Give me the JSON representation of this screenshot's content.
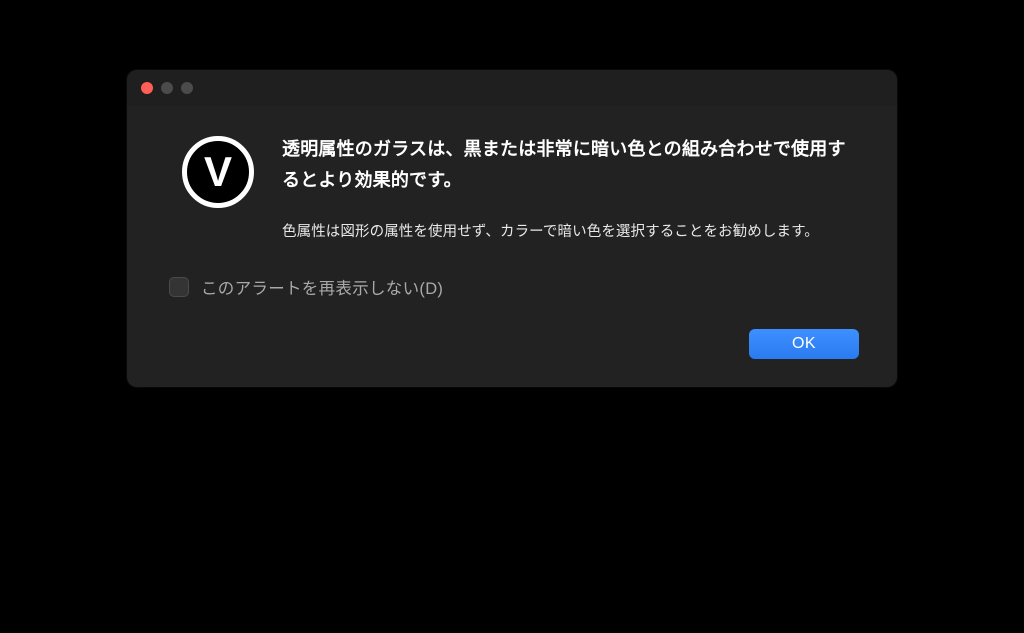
{
  "dialog": {
    "icon_letter": "V",
    "primary_message": "透明属性のガラスは、黒または非常に暗い色との組み合わせで使用するとより効果的です。",
    "secondary_message": "色属性は図形の属性を使用せず、カラーで暗い色を選択することをお勧めします。",
    "checkbox_label": "このアラートを再表示しない(D)",
    "ok_label": "OK"
  },
  "colors": {
    "accent": "#2f7ef2",
    "window_bg": "#222222"
  }
}
